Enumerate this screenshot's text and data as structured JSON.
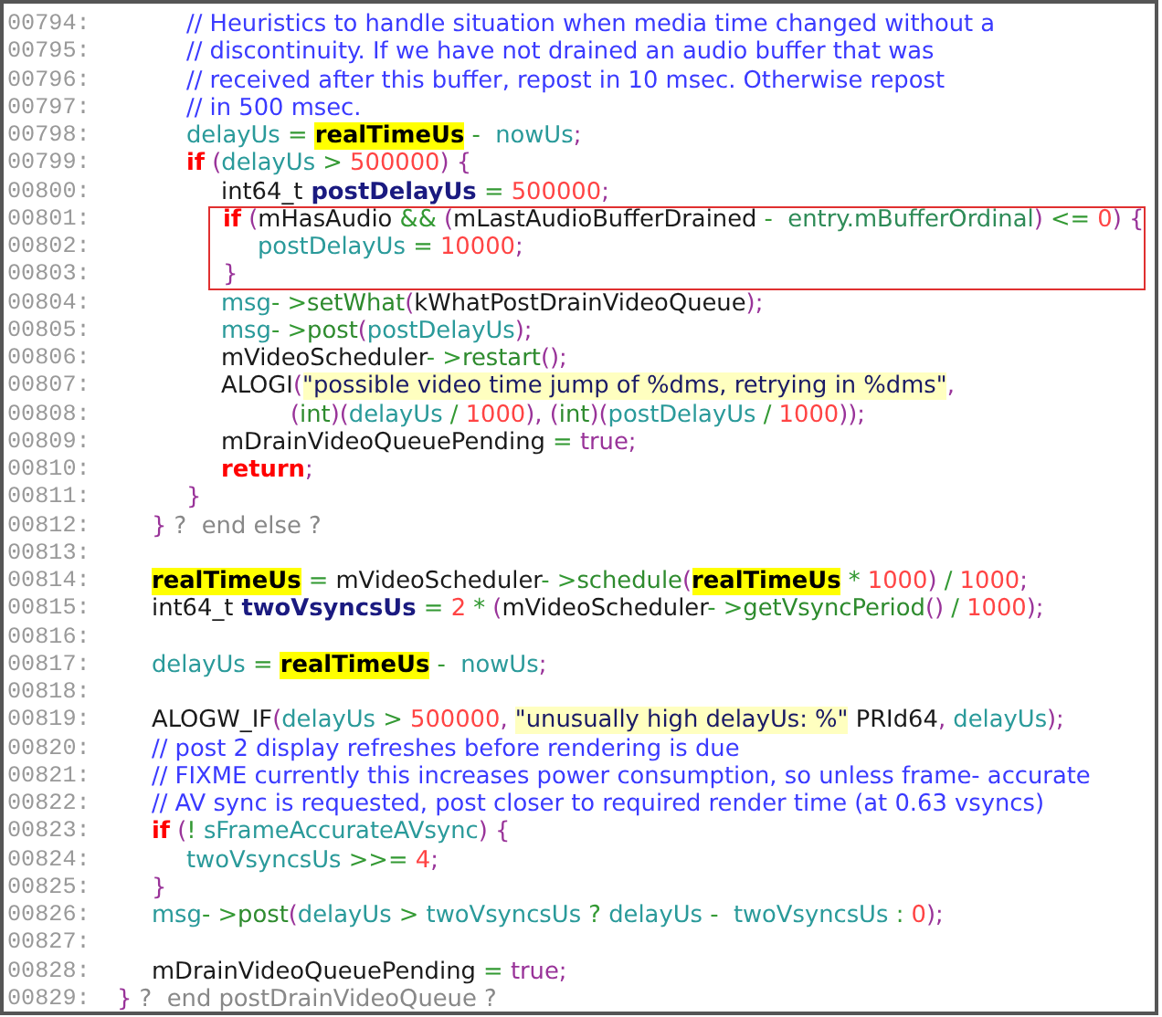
{
  "lines": [
    {
      "children": [
        {
          "children": [
            {
              "number": "00794:",
              "boxed": false,
              "tokens": [
                {
                  "kind": "comment",
                  "text": "// Heuristics to handle situation when media time changed without a"
                }
              ]
            },
            {
              "number": "00795:",
              "boxed": false,
              "tokens": [
                {
                  "kind": "comment",
                  "text": "// discontinuity. If we have not drained an audio buffer that was"
                }
              ]
            },
            {
              "number": "00796:",
              "boxed": false,
              "tokens": [
                {
                  "kind": "comment",
                  "text": "// received after this buffer, repost in 10 msec. Otherwise repost"
                }
              ]
            },
            {
              "number": "00797:",
              "boxed": false,
              "tokens": [
                {
                  "kind": "comment",
                  "text": "// in 500 msec."
                }
              ]
            },
            {
              "number": "00798:",
              "boxed": false,
              "tokens": [
                {
                  "kind": "var",
                  "text": "delayUs"
                },
                {
                  "kind": "op",
                  "text": " = "
                },
                {
                  "kind": "highlight",
                  "text": "realTimeUs"
                },
                {
                  "kind": "op",
                  "text": " - "
                },
                {
                  "kind": "var",
                  "text": " nowUs"
                },
                {
                  "kind": "paren",
                  "text": ";"
                }
              ]
            },
            {
              "number": "00799:",
              "boxed": false,
              "tokens": [
                {
                  "kind": "keyword",
                  "text": "if"
                },
                {
                  "kind": "paren",
                  "text": " ("
                },
                {
                  "kind": "var",
                  "text": "delayUs"
                },
                {
                  "kind": "op",
                  "text": " > "
                },
                {
                  "kind": "number",
                  "text": "500000"
                },
                {
                  "kind": "paren",
                  "text": ") {"
                }
              ],
              "children": [
                {
                  "number": "00800:",
                  "boxed": false,
                  "tokens": [
                    {
                      "kind": "ident",
                      "text": "int64_t"
                    },
                    {
                      "kind": "decl",
                      "text": " postDelayUs"
                    },
                    {
                      "kind": "op",
                      "text": " = "
                    },
                    {
                      "kind": "number",
                      "text": "500000"
                    },
                    {
                      "kind": "paren",
                      "text": ";"
                    }
                  ]
                },
                {
                  "number": "00801:",
                  "boxed": true,
                  "tokens": [
                    {
                      "kind": "keyword",
                      "text": "if"
                    },
                    {
                      "kind": "paren",
                      "text": " ("
                    },
                    {
                      "kind": "ident",
                      "text": "mHasAudio"
                    },
                    {
                      "kind": "op",
                      "text": " && "
                    },
                    {
                      "kind": "paren",
                      "text": "("
                    },
                    {
                      "kind": "ident",
                      "text": "mLastAudioBufferDrained"
                    },
                    {
                      "kind": "op",
                      "text": " - "
                    },
                    {
                      "kind": "member",
                      "text": " entry.mBufferOrdinal"
                    },
                    {
                      "kind": "paren",
                      "text": ")"
                    },
                    {
                      "kind": "op",
                      "text": " <= "
                    },
                    {
                      "kind": "number",
                      "text": "0"
                    },
                    {
                      "kind": "paren",
                      "text": ") {"
                    }
                  ],
                  "children": [
                    {
                      "number": "00802:",
                      "boxed": true,
                      "tokens": [
                        {
                          "kind": "var",
                          "text": "postDelayUs"
                        },
                        {
                          "kind": "op",
                          "text": " = "
                        },
                        {
                          "kind": "number",
                          "text": "10000"
                        },
                        {
                          "kind": "paren",
                          "text": ";"
                        }
                      ]
                    }
                  ]
                },
                {
                  "number": "00803:",
                  "boxed": true,
                  "tokens": [
                    {
                      "kind": "paren",
                      "text": "}"
                    }
                  ]
                },
                {
                  "number": "00804:",
                  "boxed": false,
                  "tokens": [
                    {
                      "kind": "var",
                      "text": "msg"
                    },
                    {
                      "kind": "op",
                      "text": "- >"
                    },
                    {
                      "kind": "method",
                      "text": "setWhat"
                    },
                    {
                      "kind": "paren",
                      "text": "("
                    },
                    {
                      "kind": "ident",
                      "text": "kWhatPostDrainVideoQueue"
                    },
                    {
                      "kind": "paren",
                      "text": ");"
                    }
                  ]
                },
                {
                  "number": "00805:",
                  "boxed": false,
                  "tokens": [
                    {
                      "kind": "var",
                      "text": "msg"
                    },
                    {
                      "kind": "op",
                      "text": "- >"
                    },
                    {
                      "kind": "method",
                      "text": "post"
                    },
                    {
                      "kind": "paren",
                      "text": "("
                    },
                    {
                      "kind": "var",
                      "text": "postDelayUs"
                    },
                    {
                      "kind": "paren",
                      "text": ");"
                    }
                  ]
                },
                {
                  "number": "00806:",
                  "boxed": false,
                  "tokens": [
                    {
                      "kind": "ident",
                      "text": "mVideoScheduler"
                    },
                    {
                      "kind": "op",
                      "text": "- >"
                    },
                    {
                      "kind": "method",
                      "text": "restart"
                    },
                    {
                      "kind": "paren",
                      "text": "();"
                    }
                  ]
                },
                {
                  "number": "00807:",
                  "boxed": false,
                  "tokens": [
                    {
                      "kind": "ident",
                      "text": "ALOGI"
                    },
                    {
                      "kind": "paren",
                      "text": "("
                    },
                    {
                      "kind": "string",
                      "text": "\"possible video time jump of %dms, retrying in %dms\""
                    },
                    {
                      "kind": "paren",
                      "text": ","
                    }
                  ],
                  "children": [
                    {
                      "children": [
                        {
                          "number": "00808:",
                          "boxed": false,
                          "tokens": [
                            {
                              "kind": "paren",
                              "text": "("
                            },
                            {
                              "kind": "method",
                              "text": "int"
                            },
                            {
                              "kind": "paren",
                              "text": ")("
                            },
                            {
                              "kind": "var",
                              "text": "delayUs"
                            },
                            {
                              "kind": "op",
                              "text": " / "
                            },
                            {
                              "kind": "number",
                              "text": "1000"
                            },
                            {
                              "kind": "paren",
                              "text": "), ("
                            },
                            {
                              "kind": "method",
                              "text": "int"
                            },
                            {
                              "kind": "paren",
                              "text": ")("
                            },
                            {
                              "kind": "var",
                              "text": "postDelayUs"
                            },
                            {
                              "kind": "op",
                              "text": " / "
                            },
                            {
                              "kind": "number",
                              "text": "1000"
                            },
                            {
                              "kind": "paren",
                              "text": "));"
                            }
                          ]
                        }
                      ]
                    }
                  ]
                },
                {
                  "number": "00809:",
                  "boxed": false,
                  "tokens": [
                    {
                      "kind": "ident",
                      "text": "mDrainVideoQueuePending"
                    },
                    {
                      "kind": "op",
                      "text": " = "
                    },
                    {
                      "kind": "literal",
                      "text": "true"
                    },
                    {
                      "kind": "paren",
                      "text": ";"
                    }
                  ]
                },
                {
                  "number": "00810:",
                  "boxed": false,
                  "tokens": [
                    {
                      "kind": "keyword",
                      "text": "return"
                    },
                    {
                      "kind": "paren",
                      "text": ";"
                    }
                  ]
                }
              ]
            },
            {
              "number": "00811:",
              "boxed": false,
              "tokens": [
                {
                  "kind": "paren",
                  "text": "}"
                }
              ]
            }
          ]
        },
        {
          "number": "00812:",
          "boxed": false,
          "tokens": [
            {
              "kind": "paren",
              "text": "}"
            },
            {
              "kind": "note",
              "text": " ?  end else ?"
            }
          ]
        },
        {
          "number": "00813:",
          "boxed": false
        },
        {
          "number": "00814:",
          "boxed": false,
          "tokens": [
            {
              "kind": "highlight",
              "text": "realTimeUs"
            },
            {
              "kind": "op",
              "text": " = "
            },
            {
              "kind": "ident",
              "text": "mVideoScheduler"
            },
            {
              "kind": "op",
              "text": "- >"
            },
            {
              "kind": "method",
              "text": "schedule"
            },
            {
              "kind": "paren",
              "text": "("
            },
            {
              "kind": "highlight",
              "text": "realTimeUs"
            },
            {
              "kind": "op",
              "text": " * "
            },
            {
              "kind": "number",
              "text": "1000"
            },
            {
              "kind": "paren",
              "text": ")"
            },
            {
              "kind": "op",
              "text": " / "
            },
            {
              "kind": "number",
              "text": "1000"
            },
            {
              "kind": "paren",
              "text": ";"
            }
          ]
        },
        {
          "number": "00815:",
          "boxed": false,
          "tokens": [
            {
              "kind": "ident",
              "text": "int64_t"
            },
            {
              "kind": "decl",
              "text": " twoVsyncsUs"
            },
            {
              "kind": "op",
              "text": " = "
            },
            {
              "kind": "number",
              "text": "2"
            },
            {
              "kind": "op",
              "text": " * "
            },
            {
              "kind": "paren",
              "text": "("
            },
            {
              "kind": "ident",
              "text": "mVideoScheduler"
            },
            {
              "kind": "op",
              "text": "- >"
            },
            {
              "kind": "method",
              "text": "getVsyncPeriod"
            },
            {
              "kind": "paren",
              "text": "()"
            },
            {
              "kind": "op",
              "text": " / "
            },
            {
              "kind": "number",
              "text": "1000"
            },
            {
              "kind": "paren",
              "text": ");"
            }
          ]
        },
        {
          "number": "00816:",
          "boxed": false
        },
        {
          "number": "00817:",
          "boxed": false,
          "tokens": [
            {
              "kind": "var",
              "text": "delayUs"
            },
            {
              "kind": "op",
              "text": " = "
            },
            {
              "kind": "highlight",
              "text": "realTimeUs"
            },
            {
              "kind": "op",
              "text": " - "
            },
            {
              "kind": "var",
              "text": " nowUs"
            },
            {
              "kind": "paren",
              "text": ";"
            }
          ]
        },
        {
          "number": "00818:",
          "boxed": false
        },
        {
          "number": "00819:",
          "boxed": false,
          "tokens": [
            {
              "kind": "ident",
              "text": "ALOGW_IF"
            },
            {
              "kind": "paren",
              "text": "("
            },
            {
              "kind": "var",
              "text": "delayUs"
            },
            {
              "kind": "op",
              "text": " > "
            },
            {
              "kind": "number",
              "text": "500000"
            },
            {
              "kind": "paren",
              "text": ", "
            },
            {
              "kind": "string",
              "text": "\"unusually high delayUs: %\""
            },
            {
              "kind": "ident",
              "text": " PRId64"
            },
            {
              "kind": "paren",
              "text": ", "
            },
            {
              "kind": "var",
              "text": "delayUs"
            },
            {
              "kind": "paren",
              "text": ");"
            }
          ]
        },
        {
          "number": "00820:",
          "boxed": false,
          "tokens": [
            {
              "kind": "comment",
              "text": "// post 2 display refreshes before rendering is due"
            }
          ]
        },
        {
          "number": "00821:",
          "boxed": false,
          "tokens": [
            {
              "kind": "comment",
              "text": "// FIXME currently this increases power consumption, so unless frame- accurate"
            }
          ]
        },
        {
          "number": "00822:",
          "boxed": false,
          "tokens": [
            {
              "kind": "comment",
              "text": "// AV sync is requested, post closer to required render time (at 0.63 vsyncs)"
            }
          ]
        },
        {
          "number": "00823:",
          "boxed": false,
          "tokens": [
            {
              "kind": "keyword",
              "text": "if"
            },
            {
              "kind": "paren",
              "text": " ("
            },
            {
              "kind": "op",
              "text": "! "
            },
            {
              "kind": "var",
              "text": "sFrameAccurateAVsync"
            },
            {
              "kind": "paren",
              "text": ") {"
            }
          ],
          "children": [
            {
              "number": "00824:",
              "boxed": false,
              "tokens": [
                {
                  "kind": "var",
                  "text": "twoVsyncsUs"
                },
                {
                  "kind": "op",
                  "text": " >>= "
                },
                {
                  "kind": "number",
                  "text": "4"
                },
                {
                  "kind": "paren",
                  "text": ";"
                }
              ]
            }
          ]
        },
        {
          "number": "00825:",
          "boxed": false,
          "tokens": [
            {
              "kind": "paren",
              "text": "}"
            }
          ]
        },
        {
          "number": "00826:",
          "boxed": false,
          "tokens": [
            {
              "kind": "var",
              "text": "msg"
            },
            {
              "kind": "op",
              "text": "- >"
            },
            {
              "kind": "method",
              "text": "post"
            },
            {
              "kind": "paren",
              "text": "("
            },
            {
              "kind": "var",
              "text": "delayUs"
            },
            {
              "kind": "op",
              "text": " > "
            },
            {
              "kind": "var",
              "text": "twoVsyncsUs"
            },
            {
              "kind": "op",
              "text": " ? "
            },
            {
              "kind": "var",
              "text": "delayUs"
            },
            {
              "kind": "op",
              "text": " - "
            },
            {
              "kind": "var",
              "text": " twoVsyncsUs"
            },
            {
              "kind": "op",
              "text": " : "
            },
            {
              "kind": "number",
              "text": "0"
            },
            {
              "kind": "paren",
              "text": ");"
            }
          ]
        },
        {
          "number": "00827:",
          "boxed": false
        },
        {
          "number": "00828:",
          "boxed": false,
          "tokens": [
            {
              "kind": "ident",
              "text": "mDrainVideoQueuePending"
            },
            {
              "kind": "op",
              "text": " = "
            },
            {
              "kind": "literal",
              "text": "true"
            },
            {
              "kind": "paren",
              "text": ";"
            }
          ]
        }
      ]
    },
    {
      "number": "00829:",
      "boxed": false,
      "tokens": [
        {
          "kind": "paren",
          "text": "}"
        },
        {
          "kind": "note",
          "text": " ?  end postDrainVideoQueue ?"
        }
      ]
    }
  ]
}
